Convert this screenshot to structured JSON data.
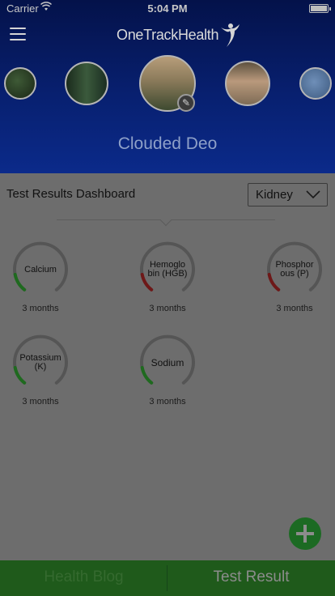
{
  "status_bar": {
    "carrier": "Carrier",
    "time": "5:04 PM"
  },
  "header": {
    "app_name": "OneTrackHealth",
    "profile_name": "Clouded Deo"
  },
  "dashboard": {
    "title": "Test Results Dashboard",
    "filter_value": "Kidney"
  },
  "tests": [
    {
      "label": "Calcium",
      "period": "3 months",
      "status_color": "#1f6a1f"
    },
    {
      "label": "Hemoglo bin (HGB)",
      "period": "3 months",
      "status_color": "#6e1818"
    },
    {
      "label": "Phosphor ous (P)",
      "period": "3 months",
      "status_color": "#6e1818"
    },
    {
      "label": "Potassium (K)",
      "period": "3 months",
      "status_color": "#1f6a1f"
    },
    {
      "label": "Sodium",
      "period": "3 months",
      "status_color": "#1f6a1f"
    }
  ],
  "tabs": {
    "blog": "Health Blog",
    "result": "Test Result"
  },
  "colors": {
    "header_blue": "#082070",
    "content_gray": "#6d6d6d",
    "tab_green": "#1f5a1b"
  }
}
